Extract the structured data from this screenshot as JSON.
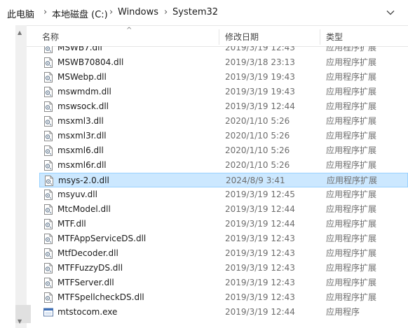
{
  "address": {
    "crumbs": [
      "此电脑",
      "本地磁盘 (C:)",
      "Windows",
      "System32"
    ]
  },
  "columns": {
    "name": "名称",
    "date": "修改日期",
    "type": "类型"
  },
  "rows": [
    {
      "name": "MSWB7.dll",
      "date": "2019/3/19 12:43",
      "type": "应用程序扩展",
      "icon": "dll"
    },
    {
      "name": "MSWB70804.dll",
      "date": "2019/3/18 23:13",
      "type": "应用程序扩展",
      "icon": "dll"
    },
    {
      "name": "MSWebp.dll",
      "date": "2019/3/19 19:43",
      "type": "应用程序扩展",
      "icon": "dll"
    },
    {
      "name": "mswmdm.dll",
      "date": "2019/3/19 19:43",
      "type": "应用程序扩展",
      "icon": "dll"
    },
    {
      "name": "mswsock.dll",
      "date": "2019/3/19 12:44",
      "type": "应用程序扩展",
      "icon": "dll"
    },
    {
      "name": "msxml3.dll",
      "date": "2020/1/10 5:26",
      "type": "应用程序扩展",
      "icon": "dll"
    },
    {
      "name": "msxml3r.dll",
      "date": "2020/1/10 5:26",
      "type": "应用程序扩展",
      "icon": "dll"
    },
    {
      "name": "msxml6.dll",
      "date": "2020/1/10 5:26",
      "type": "应用程序扩展",
      "icon": "dll"
    },
    {
      "name": "msxml6r.dll",
      "date": "2020/1/10 5:26",
      "type": "应用程序扩展",
      "icon": "dll"
    },
    {
      "name": "msys-2.0.dll",
      "date": "2024/8/9 3:41",
      "type": "应用程序扩展",
      "icon": "dll",
      "selected": true
    },
    {
      "name": "msyuv.dll",
      "date": "2019/3/19 12:45",
      "type": "应用程序扩展",
      "icon": "dll"
    },
    {
      "name": "MtcModel.dll",
      "date": "2019/3/19 12:44",
      "type": "应用程序扩展",
      "icon": "dll"
    },
    {
      "name": "MTF.dll",
      "date": "2019/3/19 12:44",
      "type": "应用程序扩展",
      "icon": "dll"
    },
    {
      "name": "MTFAppServiceDS.dll",
      "date": "2019/3/19 12:43",
      "type": "应用程序扩展",
      "icon": "dll"
    },
    {
      "name": "MtfDecoder.dll",
      "date": "2019/3/19 12:43",
      "type": "应用程序扩展",
      "icon": "dll"
    },
    {
      "name": "MTFFuzzyDS.dll",
      "date": "2019/3/19 12:43",
      "type": "应用程序扩展",
      "icon": "dll"
    },
    {
      "name": "MTFServer.dll",
      "date": "2019/3/19 12:43",
      "type": "应用程序扩展",
      "icon": "dll"
    },
    {
      "name": "MTFSpellcheckDS.dll",
      "date": "2019/3/19 12:43",
      "type": "应用程序扩展",
      "icon": "dll"
    },
    {
      "name": "mtstocom.exe",
      "date": "2019/3/19 12:44",
      "type": "应用程序",
      "icon": "exe"
    }
  ],
  "colors": {
    "selected_bg": "#cce8ff",
    "selected_border": "#99d1ff",
    "muted_text": "#6d6d6d"
  }
}
